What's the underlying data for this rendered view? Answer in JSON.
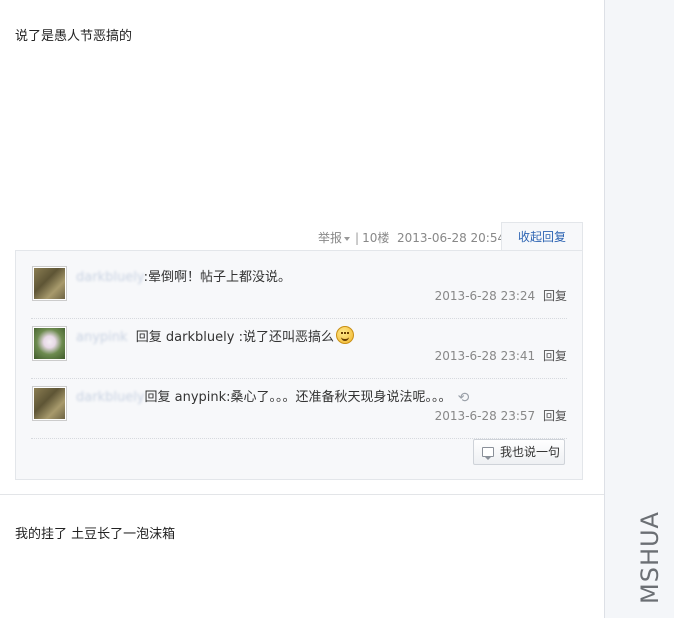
{
  "posts": {
    "first_text": "说了是愚人节恶搞的",
    "second_text": "我的挂了 土豆长了一泡沫箱"
  },
  "tail": {
    "report_label": "举报",
    "separator": "|",
    "floor": "10楼",
    "timestamp": "2013-06-28 20:54",
    "collapse_label": "收起回复"
  },
  "replies": [
    {
      "user": "darkbluely",
      "prefix": "",
      "text": ":晕倒啊！帖子上都没说。",
      "time": "2013-6-28 23:24",
      "reply_label": "回复",
      "avatar": "cat"
    },
    {
      "user": "anypink",
      "prefix": "回复 darkbluely ",
      "text": ":说了还叫恶搞么",
      "time": "2013-6-28 23:41",
      "reply_label": "回复",
      "avatar": "flower",
      "emoji": "smiley-icon"
    },
    {
      "user": "darkbluely",
      "prefix": "回复 anypink",
      "text": ":桑心了。。。还准备秋天现身说法呢。。。",
      "time": "2013-6-28 23:57",
      "reply_label": "回复",
      "avatar": "cat",
      "emoji": "refresh-icon"
    }
  ],
  "say_button_label": "我也说一句",
  "watermark": "MSHUA",
  "colors": {
    "link": "#2d64b3",
    "meta": "#888888",
    "box_bg": "#f7f8fa"
  }
}
